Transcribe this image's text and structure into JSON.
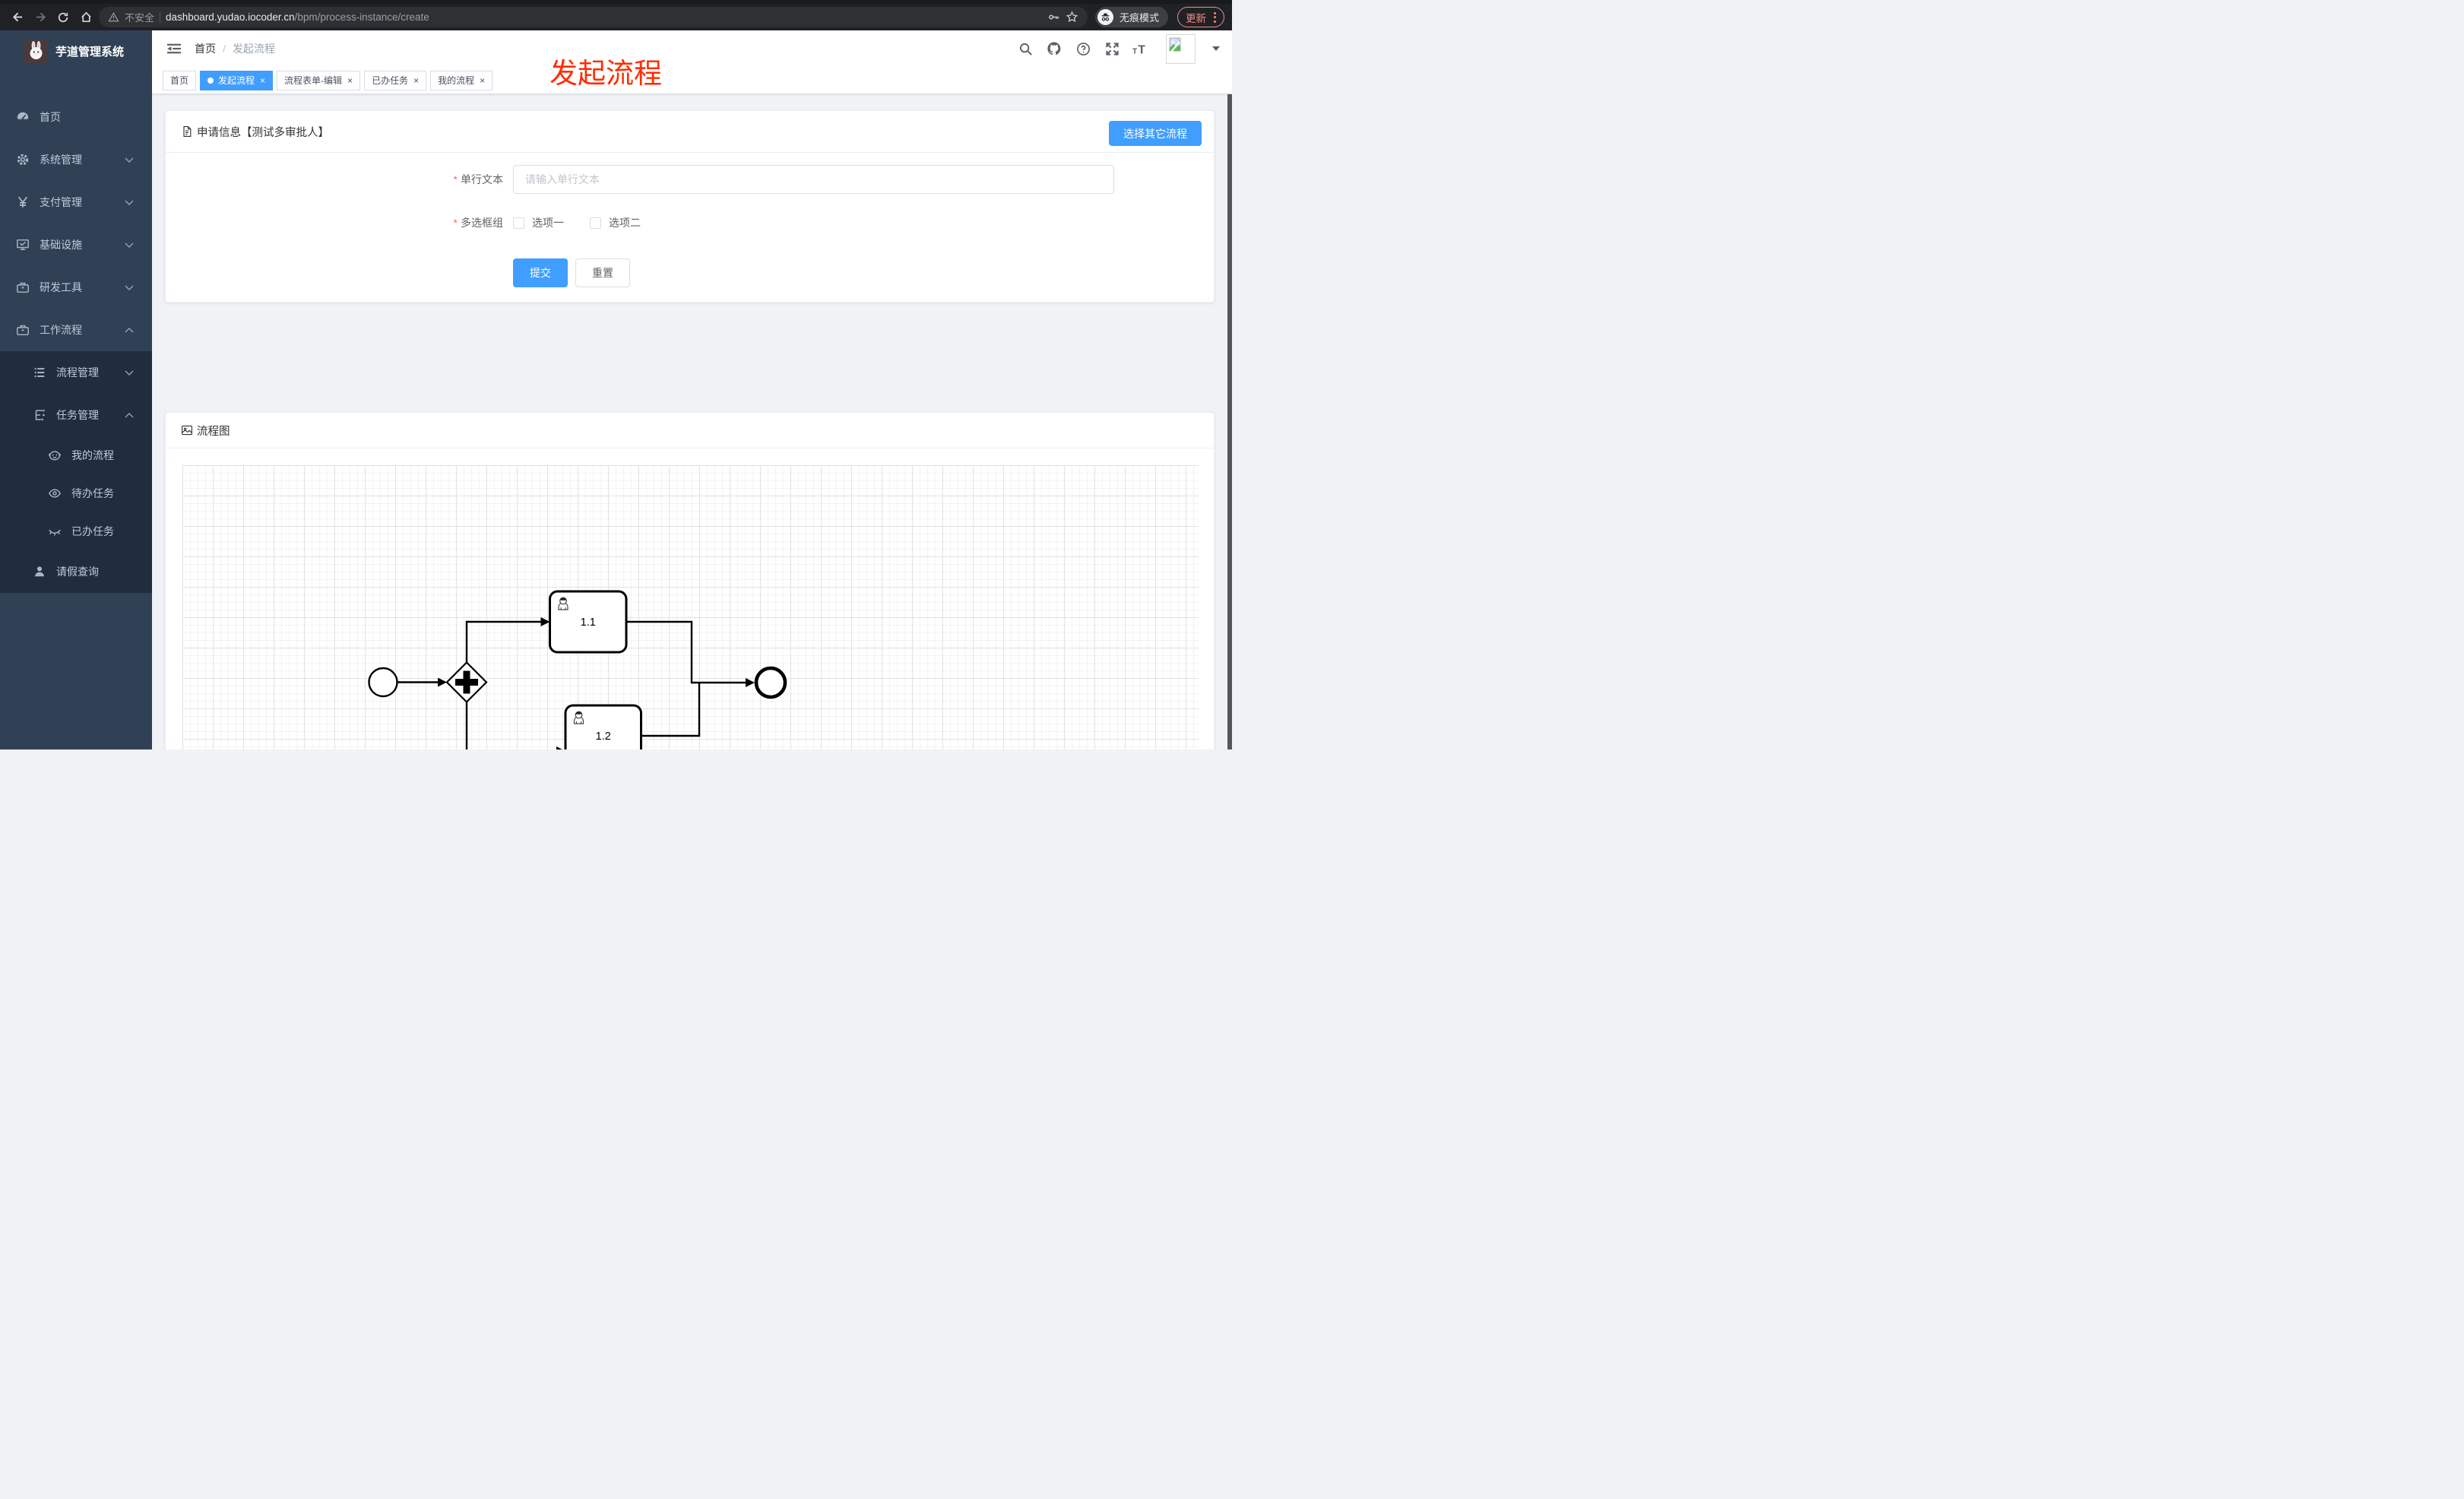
{
  "browser": {
    "insecure_label": "不安全",
    "url_host": "dashboard.yudao.iocoder.cn",
    "url_path": "/bpm/process-instance/create",
    "incognito_label": "无痕模式",
    "update_label": "更新"
  },
  "annotation": {
    "title": "发起流程",
    "color": "#fe2c00"
  },
  "sidebar": {
    "logo_title": "芋道管理系统",
    "items": [
      {
        "label": "首页",
        "icon": "dashboard-icon",
        "level": 1,
        "chevron": ""
      },
      {
        "label": "系统管理",
        "icon": "gear-icon",
        "level": 1,
        "chevron": "down"
      },
      {
        "label": "支付管理",
        "icon": "yen-icon",
        "level": 1,
        "chevron": "down"
      },
      {
        "label": "基础设施",
        "icon": "monitor-icon",
        "level": 1,
        "chevron": "down"
      },
      {
        "label": "研发工具",
        "icon": "toolbox-icon",
        "level": 1,
        "chevron": "down"
      },
      {
        "label": "工作流程",
        "icon": "briefcase-icon",
        "level": 1,
        "chevron": "up"
      },
      {
        "label": "流程管理",
        "icon": "tree-icon",
        "level": 2,
        "chevron": "down"
      },
      {
        "label": "任务管理",
        "icon": "flow-icon",
        "level": 2,
        "chevron": "up"
      },
      {
        "label": "我的流程",
        "icon": "face-icon",
        "level": 3,
        "chevron": ""
      },
      {
        "label": "待办任务",
        "icon": "eye-icon",
        "level": 3,
        "chevron": ""
      },
      {
        "label": "已办任务",
        "icon": "eye-closed-icon",
        "level": 3,
        "chevron": ""
      },
      {
        "label": "请假查询",
        "icon": "user-icon",
        "level": 2,
        "chevron": ""
      }
    ]
  },
  "header": {
    "breadcrumb_home": "首页",
    "breadcrumb_separator": "/",
    "breadcrumb_current": "发起流程"
  },
  "tags": [
    {
      "label": "首页",
      "active": false,
      "closable": false
    },
    {
      "label": "发起流程",
      "active": true,
      "closable": true
    },
    {
      "label": "流程表单-编辑",
      "active": false,
      "closable": true
    },
    {
      "label": "已办任务",
      "active": false,
      "closable": true
    },
    {
      "label": "我的流程",
      "active": false,
      "closable": true
    }
  ],
  "form_card": {
    "title": "申请信息【测试多审批人】",
    "action_button": "选择其它流程",
    "required_mark": "*",
    "fields": {
      "text": {
        "label": "单行文本",
        "placeholder": "请输入单行文本",
        "value": ""
      },
      "checkbox_group": {
        "label": "多选框组",
        "options": [
          {
            "label": "选项一",
            "checked": false
          },
          {
            "label": "选项二",
            "checked": false
          }
        ]
      }
    },
    "submit_label": "提交",
    "reset_label": "重置"
  },
  "diagram_card": {
    "title": "流程图",
    "nodes": [
      {
        "id": "start",
        "type": "start-event"
      },
      {
        "id": "gateway",
        "type": "parallel-gateway"
      },
      {
        "id": "task-1-1",
        "type": "user-task",
        "label": "1.1"
      },
      {
        "id": "task-1-2",
        "type": "user-task",
        "label": "1.2"
      },
      {
        "id": "end",
        "type": "end-event"
      }
    ],
    "edges": [
      "start→gateway",
      "gateway→task-1-1",
      "gateway→task-1-2",
      "task-1-1→end",
      "task-1-2→end"
    ]
  },
  "icons": {
    "close_glyph": "×"
  },
  "colors": {
    "accent": "#409eff",
    "sidebar_bg": "#304156",
    "submenu_bg": "#1f2d3d",
    "annotation_red": "#fe2c00",
    "chrome_bg": "#202124",
    "update_red": "#f28b82"
  }
}
